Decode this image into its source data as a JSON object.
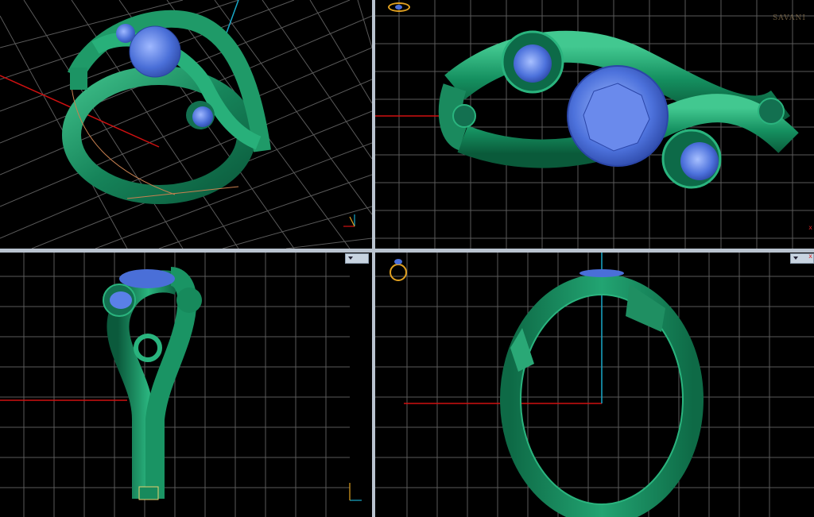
{
  "app": {
    "type": "CAD jewelry 4-viewport modeler"
  },
  "viewports": [
    {
      "id": "perspective",
      "label": "",
      "axis_indicator": "x y z"
    },
    {
      "id": "top",
      "label": "",
      "has_ring_icon": true
    },
    {
      "id": "front",
      "label": "",
      "has_menu_button": true,
      "axis_indicator": "x y"
    },
    {
      "id": "side",
      "label": "",
      "has_menu_button": true,
      "has_ring_icon": true
    }
  ],
  "watermark": {
    "text": "SAVANI"
  },
  "axis_labels": {
    "x": "x"
  },
  "colors": {
    "background": "#000000",
    "grid": "#5a5a5a",
    "metal": "#1a8a5e",
    "gem": "#4a6fd8",
    "x_axis": "#d01010",
    "y_axis": "#18a8c8",
    "divider": "#b9c3cf",
    "icon_gold": "#e0a020"
  }
}
